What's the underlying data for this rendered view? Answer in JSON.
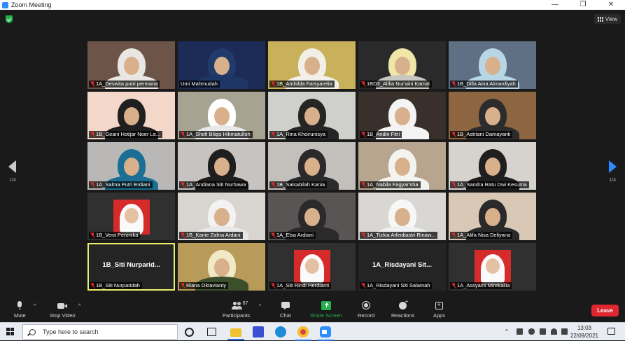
{
  "window": {
    "title": "Zoom Meeting",
    "controls": [
      "—",
      "❐",
      "✕"
    ]
  },
  "view_button": {
    "label": "View"
  },
  "pagination": {
    "left": "1/4",
    "right": "1/4"
  },
  "participants": [
    {
      "name": "1A_Deswita putri permana",
      "muted": true,
      "kind": "video",
      "bg": "#6d5448",
      "scarf": "#e9e6e3",
      "cloth": "#e9e6e3"
    },
    {
      "name": "Umi Mahmudah",
      "muted": false,
      "kind": "video",
      "bg": "#1d2b57",
      "scarf": "#203a6b",
      "cloth": "#1e3666"
    },
    {
      "name": "1B_Amhilda Farsyarelia",
      "muted": true,
      "kind": "video",
      "bg": "#c9b05a",
      "scarf": "#f1efe8",
      "cloth": "#f1efe8"
    },
    {
      "name": "1BD3_Alifia Nur'aini Kamal",
      "muted": true,
      "kind": "video",
      "bg": "#2a2a2a",
      "scarf": "#eee7a8",
      "cloth": "#c8c7c2"
    },
    {
      "name": "1B_Dilla Aina Almardiyah",
      "muted": true,
      "kind": "video",
      "bg": "#5f6f84",
      "scarf": "#b8d7e6",
      "cloth": "#b8d7e6"
    },
    {
      "name": "1B_Geani Hotijar Noer Le...",
      "muted": true,
      "kind": "video",
      "bg": "#f3d7c9",
      "scarf": "#1f1f1f",
      "cloth": "#1f1f1f"
    },
    {
      "name": "1A_Shofi Bilqis Hikmatulloh",
      "muted": true,
      "kind": "video",
      "bg": "#a6a393",
      "scarf": "#ffffff",
      "cloth": "#e8e8e8"
    },
    {
      "name": "1A_Rina Khoirunisya",
      "muted": true,
      "kind": "video",
      "bg": "#cfd0cc",
      "scarf": "#252525",
      "cloth": "#252525"
    },
    {
      "name": "1B_Andin Fitri",
      "muted": true,
      "kind": "video",
      "bg": "#3a302b",
      "scarf": "#f4f4f4",
      "cloth": "#f4f4f4"
    },
    {
      "name": "1B_Astriani Damayanti",
      "muted": true,
      "kind": "video",
      "bg": "#8e6541",
      "scarf": "#2c2c2c",
      "cloth": "#2c2c2c"
    },
    {
      "name": "1A_Salma Putri Erdiani",
      "muted": true,
      "kind": "video",
      "bg": "#b9b8b6",
      "scarf": "#1b6f95",
      "cloth": "#1b6f95"
    },
    {
      "name": "1A_Andiana Siti Nurhawa",
      "muted": true,
      "kind": "video",
      "bg": "#c6c3c0",
      "scarf": "#1e1e1e",
      "cloth": "#1e1e1e"
    },
    {
      "name": "1B_Salsabilah Kania",
      "muted": true,
      "kind": "video",
      "bg": "#c3bfbb",
      "scarf": "#2a2a2a",
      "cloth": "#2a2a2a"
    },
    {
      "name": "1A_Nabila Fagyar'sha",
      "muted": true,
      "kind": "video",
      "bg": "#b8a58f",
      "scarf": "#f3f3f0",
      "cloth": "#f3f3f0"
    },
    {
      "name": "1A_Sandra Ratu Dwi Kesuma",
      "muted": true,
      "kind": "video",
      "bg": "#d6d2cd",
      "scarf": "#1f1f1f",
      "cloth": "#1f1f1f"
    },
    {
      "name": "1B_Vera Peronika",
      "muted": true,
      "kind": "photo",
      "bg": "#303030"
    },
    {
      "name": "1B_Kanie Zahra Ardani",
      "muted": true,
      "kind": "video",
      "bg": "#d8d4cf",
      "scarf": "#f2f2f2",
      "cloth": "#e8e8e8"
    },
    {
      "name": "1A_Elsa Ardiani",
      "muted": true,
      "kind": "video",
      "bg": "#595555",
      "scarf": "#2a2a2a",
      "cloth": "#2a2a2a"
    },
    {
      "name": "1A_Tizkia Arlindiastri Rinaw...",
      "muted": true,
      "kind": "video",
      "bg": "#d9d7d3",
      "scarf": "#f7f7f7",
      "cloth": "#f0f0f0"
    },
    {
      "name": "1A_Alifa Nisa Deliyana",
      "muted": true,
      "kind": "video",
      "bg": "#d8c8b5",
      "scarf": "#2a2a2a",
      "cloth": "#2a2a2a"
    },
    {
      "name": "1B_Siti Nurparidah",
      "muted": true,
      "kind": "name",
      "display": "1B_Siti  Nurparid...",
      "active": true
    },
    {
      "name": "Riana Oktavianty",
      "muted": true,
      "kind": "video",
      "bg": "#b89a59",
      "scarf": "#f1e9c6",
      "cloth": "#3b4f2a"
    },
    {
      "name": "1A_Siti Rindi Herdianti",
      "muted": true,
      "kind": "photo",
      "bg": "#303030"
    },
    {
      "name": "1A_Risdayani Siti Salamah",
      "muted": true,
      "kind": "name",
      "display": "1A_Risdayani  Sit..."
    },
    {
      "name": "1A_Assyami Mirekallia",
      "muted": true,
      "kind": "photo",
      "bg": "#303030"
    }
  ],
  "toolbar": {
    "mute": "Mute",
    "stop_video": "Stop Video",
    "participants": "Participants",
    "participants_count": "87",
    "chat": "Chat",
    "share_screen": "Share Screen",
    "record": "Record",
    "reactions": "Reactions",
    "apps": "Apps",
    "leave": "Leave"
  },
  "taskbar": {
    "search_placeholder": "Type here to search",
    "time": "13:03",
    "date": "22/09/2021",
    "tray_chevron": "^"
  },
  "colors": {
    "accent": "#2d8cff",
    "leave": "#e0262f",
    "share": "#24b14d",
    "active_speaker": "#e7f06a"
  }
}
